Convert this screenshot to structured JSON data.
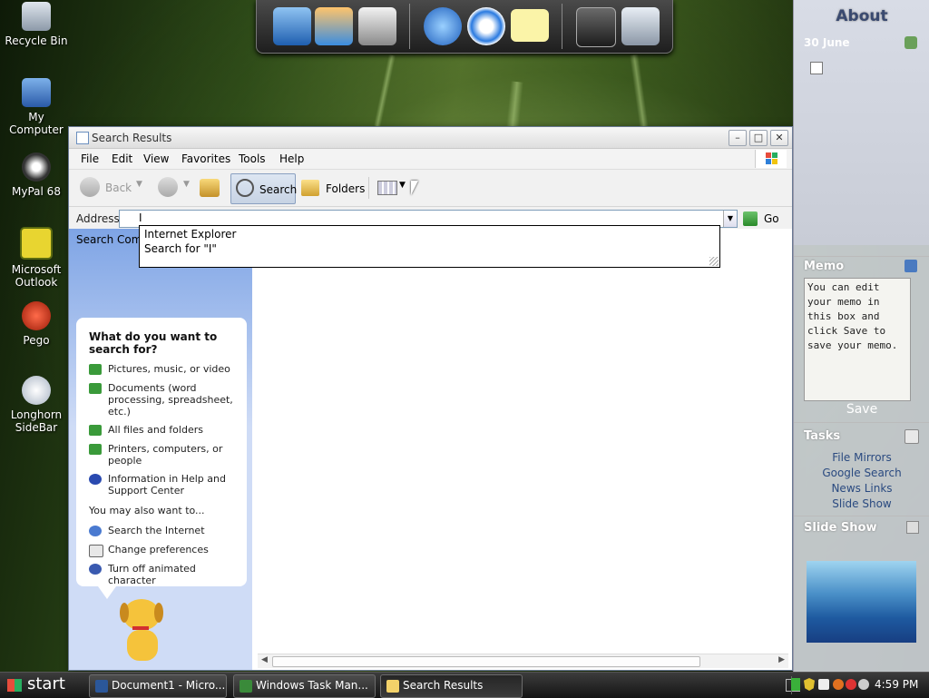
{
  "desktop": {
    "icons": [
      {
        "label": "Recycle Bin"
      },
      {
        "label": "My Computer"
      },
      {
        "label": "MyPal 68"
      },
      {
        "label": "Microsoft Outlook"
      },
      {
        "label": "Pego"
      },
      {
        "label": "Longhorn SideBar"
      }
    ]
  },
  "window": {
    "title": "Search Results",
    "menu": [
      "File",
      "Edit",
      "View",
      "Favorites",
      "Tools",
      "Help"
    ],
    "toolbar": {
      "back_label": "Back",
      "search_label": "Search",
      "folders_label": "Folders"
    },
    "address": {
      "label": "Address",
      "value": "I",
      "go_label": "Go",
      "suggestions": [
        "Internet Explorer",
        "Search for \"I\""
      ]
    },
    "search_comp_label": "Search Comp",
    "assistant": {
      "question": "What do you want to search for?",
      "options": [
        "Pictures, music, or video",
        "Documents (word processing, spreadsheet, etc.)",
        "All files and folders",
        "Printers, computers, or people",
        "Information in Help and Support Center"
      ],
      "also_label": "You may also want to...",
      "also_options": [
        "Search the Internet",
        "Change preferences",
        "Turn off animated character"
      ]
    }
  },
  "sidebar": {
    "title": "About",
    "date": "30 June",
    "memo_title": "Memo",
    "memo_text": "You can edit your memo in this box and click Save to save your memo.",
    "save_label": "Save",
    "tasks_title": "Tasks",
    "tasks": [
      "File Mirrors",
      "Google Search",
      "News Links",
      "Slide Show"
    ],
    "slideshow_title": "Slide Show"
  },
  "taskbar": {
    "start_label": "start",
    "items": [
      "Document1 - Micro...",
      "Windows Task Man...",
      "Search Results"
    ],
    "clock": "4:59 PM"
  },
  "colors": {
    "accent": "#3a9a3a",
    "sidebar_text": "#2a4a80",
    "taskbar": "#1e1e1e"
  }
}
